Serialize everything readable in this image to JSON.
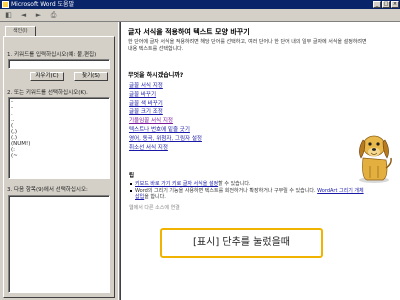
{
  "window": {
    "title": "Microsoft Word 도움말",
    "controls": [
      "_",
      "□",
      "×"
    ]
  },
  "toolbar": {
    "buttons": [
      "◧",
      "◄",
      "►",
      "⎙"
    ]
  },
  "left_pane": {
    "tabs": [
      "색인(I)"
    ],
    "step1_label": "1. 키워드를 입력하십시오(예: 붙,편집)",
    "keyword_value": "",
    "clear_button": "지우기(C)",
    "search_button": "찾기(S)",
    "step2_label": "2. 또는 키워드를 선택하십시오(K).",
    "keywords": [
      "-",
      "-",
      ".",
      "..",
      "(",
      "(,)",
      "(.)",
      "(NUM!)",
      "(:",
      "(~"
    ],
    "step3_label": "3. 다음 항목(9)에서 선택하십시오:"
  },
  "content": {
    "title": "글자 서식을 적용하여 텍스트 모양 바꾸기",
    "description": "한 단어에 글자 서식을 적용하려면 해당 단어를 선택하고, 여러 단어나 한 단어 내의 일부 글자에 서식을 설정하려면 내용 텍스트를 선택합니다.",
    "question": "무엇을 하시겠습니까?",
    "links": [
      {
        "text": "글꼴 서식 지정",
        "visited": false
      },
      {
        "text": "글꼴 바꾸기",
        "visited": false
      },
      {
        "text": "글꼴 색 바꾸기",
        "visited": false
      },
      {
        "text": "글꼴 크기 조정",
        "visited": false
      },
      {
        "text": "기울임꼴 서식 지정",
        "visited": true
      },
      {
        "text": "텍스트나 번호에 밑줄 긋기",
        "visited": false
      },
      {
        "text": "영어, 동곡, 위첨자, 그림자 설정",
        "visited": false
      },
      {
        "text": "취소선 서식 지정",
        "visited": false
      }
    ],
    "tip_heading": "팁",
    "tips": [
      {
        "before": "",
        "link": "키보드 바로 가기 키로 글자 서식을 설정",
        "after": "할 수 있습니다."
      },
      {
        "before": "Word의 그리기 기능을 사용하면 텍스트를 회전하거나 확장하거나 구부릴 수 있습니다. ",
        "link": "WordArt 그리기 개체 삽입",
        "after": "을 합니다."
      }
    ],
    "more": "웹에서 다른 소스에 연결"
  },
  "caption": "[표시] 단추를 눌렀을때",
  "colors": {
    "titlebar": "#0a246a",
    "link": "#1a1aa6",
    "visited": "#7a1a9a",
    "caption_border": "#f0b400"
  }
}
